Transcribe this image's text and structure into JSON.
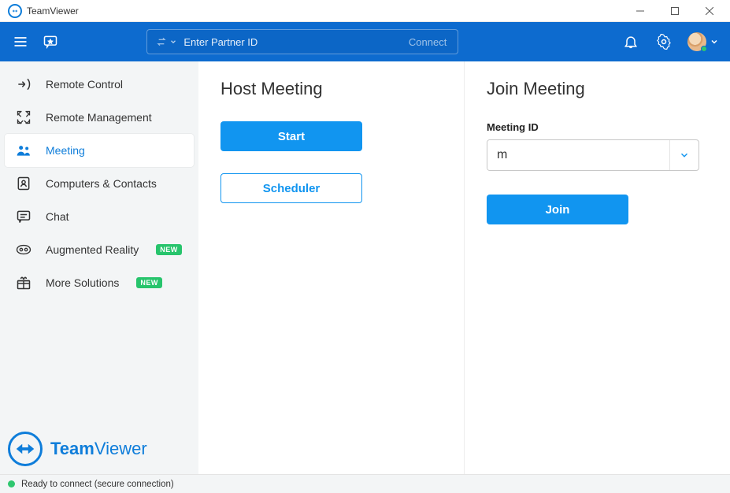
{
  "titlebar": {
    "title": "TeamViewer"
  },
  "header": {
    "partner_placeholder": "Enter Partner ID",
    "connect_label": "Connect"
  },
  "sidebar": {
    "items": [
      {
        "label": "Remote Control"
      },
      {
        "label": "Remote Management"
      },
      {
        "label": "Meeting"
      },
      {
        "label": "Computers & Contacts"
      },
      {
        "label": "Chat"
      },
      {
        "label": "Augmented Reality",
        "badge": "NEW"
      },
      {
        "label": "More Solutions",
        "badge": "NEW"
      }
    ],
    "brand_bold": "Team",
    "brand_rest": "Viewer"
  },
  "main": {
    "host_title": "Host Meeting",
    "start_label": "Start",
    "scheduler_label": "Scheduler",
    "join_title": "Join Meeting",
    "meeting_id_label": "Meeting ID",
    "meeting_id_value": "m",
    "join_label": "Join"
  },
  "statusbar": {
    "text": "Ready to connect (secure connection)"
  }
}
